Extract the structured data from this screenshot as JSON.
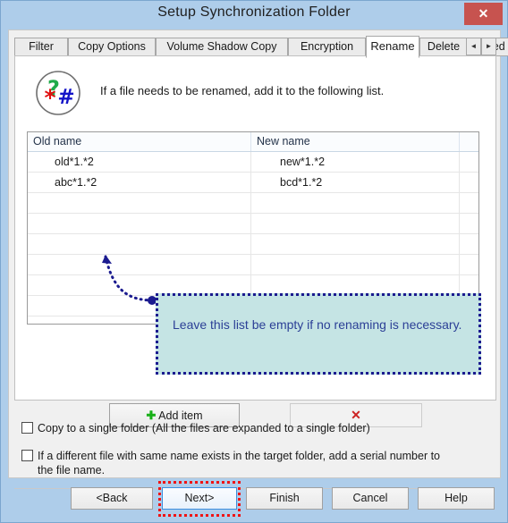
{
  "window": {
    "title": "Setup Synchronization Folder",
    "close_label": "✕",
    "chrome_color": "#aecdea",
    "close_color": "#c7534f"
  },
  "tabs": [
    {
      "label": "Filter",
      "active": false
    },
    {
      "label": "Copy Options",
      "active": false
    },
    {
      "label": "Volume Shadow Copy",
      "active": false
    },
    {
      "label": "Encryption",
      "active": false
    },
    {
      "label": "Rename",
      "active": true
    },
    {
      "label": "Delete",
      "active": false
    },
    {
      "label": "Sched",
      "active": false
    }
  ],
  "tab_scroll": {
    "prev_label": "◄",
    "next_label": "►"
  },
  "page": {
    "icon_name": "rename-wildcard-icon",
    "icon_glyphs": {
      "question": "?",
      "asterisk": "*",
      "hash": "#"
    },
    "icon_colors": {
      "question": "#1faa4a",
      "asterisk": "#e01010",
      "hash": "#1414c8"
    },
    "description": "If a file needs to be renamed, add it to the following list."
  },
  "table": {
    "columns": [
      "Old name",
      "New name",
      ""
    ],
    "rows": [
      {
        "old_name": "old*1.*2",
        "new_name": "new*1.*2"
      },
      {
        "old_name": "abc*1.*2",
        "new_name": "bcd*1.*2"
      },
      {
        "old_name": "",
        "new_name": ""
      },
      {
        "old_name": "",
        "new_name": ""
      },
      {
        "old_name": "",
        "new_name": ""
      },
      {
        "old_name": "",
        "new_name": ""
      },
      {
        "old_name": "",
        "new_name": ""
      },
      {
        "old_name": "",
        "new_name": ""
      }
    ]
  },
  "callout": {
    "text": "Leave this list be empty if no renaming is necessary.",
    "fill_color": "#c5e4e4",
    "border_color": "#1b1b8f",
    "text_color": "#2b3f96"
  },
  "actions": {
    "add_label": "Add item",
    "add_icon": "plus-icon",
    "delete_icon": "red-x-icon",
    "delete_label": "✕"
  },
  "options": [
    {
      "label": "Copy to a single folder (All the files are expanded to a single folder)",
      "checked": false
    },
    {
      "label": "If a different file with same name exists in the target folder, add a serial number to the file name.",
      "checked": false
    }
  ],
  "footer": {
    "buttons": [
      {
        "label": "<Back",
        "focused": false
      },
      {
        "label": "Next>",
        "focused": true
      },
      {
        "label": "Finish",
        "focused": false
      },
      {
        "label": "Cancel",
        "focused": false
      },
      {
        "label": "Help",
        "focused": false
      }
    ],
    "highlight_color": "#f01414"
  }
}
